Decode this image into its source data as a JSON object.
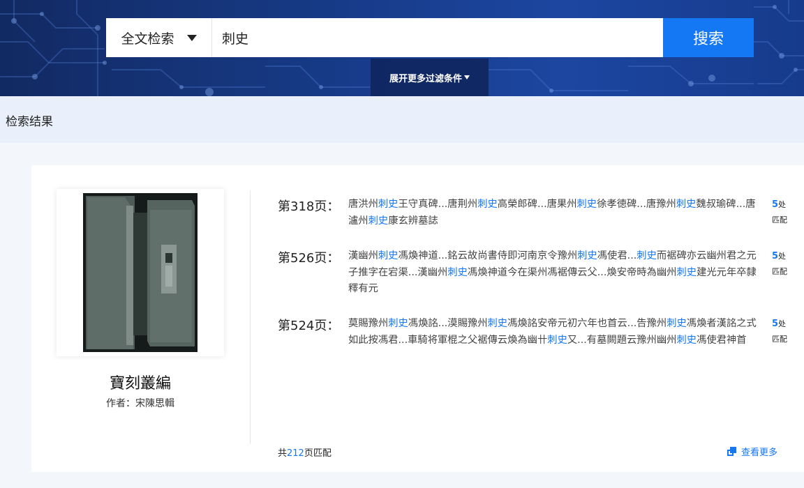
{
  "search": {
    "type_label": "全文检索",
    "query": "刺史",
    "button_label": "搜索",
    "filter_toggle_label": "展开更多过滤条件"
  },
  "results_header": {
    "title": "检索结果"
  },
  "book": {
    "title": "寶刻叢編",
    "author_label": "作者：",
    "author": "宋陳思輯",
    "cover_icon": "book-cover-image"
  },
  "matches": [
    {
      "page_label": "第318页：",
      "snippet": [
        {
          "t": "唐洪州"
        },
        {
          "t": "刺史",
          "hl": true
        },
        {
          "t": "王守真碑...唐荆州"
        },
        {
          "t": "刺史",
          "hl": true
        },
        {
          "t": "高榮郎碑...唐果州"
        },
        {
          "t": "刺史",
          "hl": true
        },
        {
          "t": "徐孝徳碑...唐豫州"
        },
        {
          "t": "刺史",
          "hl": true
        },
        {
          "t": "魏叔瑜碑...唐瀘州"
        },
        {
          "t": "刺史",
          "hl": true
        },
        {
          "t": "康玄辨墓誌"
        }
      ],
      "count_num": "5",
      "count_a": "处",
      "count_b": "匹配"
    },
    {
      "page_label": "第526页：",
      "snippet": [
        {
          "t": "漢幽州"
        },
        {
          "t": "刺史",
          "hl": true
        },
        {
          "t": "馮煥神道...銘云故尚書侍即河南京令豫州"
        },
        {
          "t": "刺史",
          "hl": true
        },
        {
          "t": "馮使君..."
        },
        {
          "t": "刺史",
          "hl": true
        },
        {
          "t": "而裾碑亦云幽州君之元子推字在宕渠...漢幽州"
        },
        {
          "t": "刺史",
          "hl": true
        },
        {
          "t": "馮煥神道今在渠州馮裾傳云父...煥安帝時為幽州"
        },
        {
          "t": "刺史",
          "hl": true
        },
        {
          "t": "建光元年卒隸釋有元"
        }
      ],
      "count_num": "5",
      "count_a": "处",
      "count_b": "匹配"
    },
    {
      "page_label": "第524页：",
      "snippet": [
        {
          "t": "莫賜豫州"
        },
        {
          "t": "刺史",
          "hl": true
        },
        {
          "t": "馮煥詺...漠賜豫州"
        },
        {
          "t": "刺史",
          "hl": true
        },
        {
          "t": "馮煥詺安帝元初六年也首云...告豫州"
        },
        {
          "t": "刺史",
          "hl": true
        },
        {
          "t": "馮煥者漢詺之式如此按馮君...車騎将軍棍之父裾傳云煥為幽卄"
        },
        {
          "t": "刺史",
          "hl": true
        },
        {
          "t": "又...有墓闕題云豫州幽州"
        },
        {
          "t": "刺史",
          "hl": true
        },
        {
          "t": "馮使君神首"
        }
      ],
      "count_num": "5",
      "count_a": "处",
      "count_b": "匹配"
    }
  ],
  "footer": {
    "total_prefix": "共",
    "total_num": "212",
    "total_suffix": "页匹配",
    "more_label": "查看更多",
    "more_icon": "copy-icon"
  },
  "colors": {
    "accent": "#1477f3",
    "hero": "#173a86"
  }
}
